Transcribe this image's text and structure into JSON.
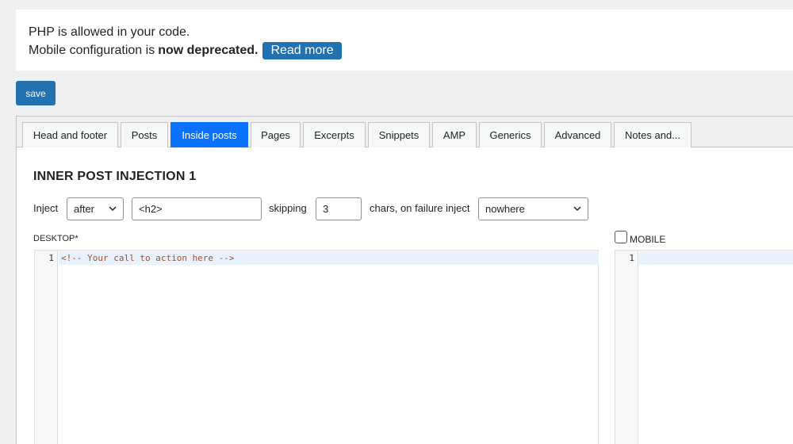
{
  "notice": {
    "line1": "PHP is allowed in your code.",
    "line2_prefix": "Mobile configuration is",
    "line2_bold": "now deprecated.",
    "read_more": "Read more"
  },
  "toolbar": {
    "save_label": "save"
  },
  "tabs": [
    {
      "label": "Head and footer"
    },
    {
      "label": "Posts"
    },
    {
      "label": "Inside posts",
      "active": true
    },
    {
      "label": "Pages"
    },
    {
      "label": "Excerpts"
    },
    {
      "label": "Snippets"
    },
    {
      "label": "AMP"
    },
    {
      "label": "Generics"
    },
    {
      "label": "Advanced"
    },
    {
      "label": "Notes and..."
    }
  ],
  "section": {
    "title": "INNER POST INJECTION 1",
    "inject_label": "Inject",
    "position_select": "after",
    "tag_input": "<h2>",
    "skipping_label": "skipping",
    "skip_chars": "3",
    "failure_label": "chars, on failure inject",
    "failure_select": "nowhere"
  },
  "editors": {
    "desktop_label": "DESKTOP*",
    "mobile_label": "MOBILE",
    "mobile_checked": false,
    "desktop_line_number": "1",
    "desktop_code": "<!-- Your call to action here -->",
    "mobile_line_number": "1",
    "mobile_code": ""
  },
  "colors": {
    "primary_button": "#2271b1",
    "active_tab": "#0a72ff",
    "comment": "#a0522d"
  }
}
